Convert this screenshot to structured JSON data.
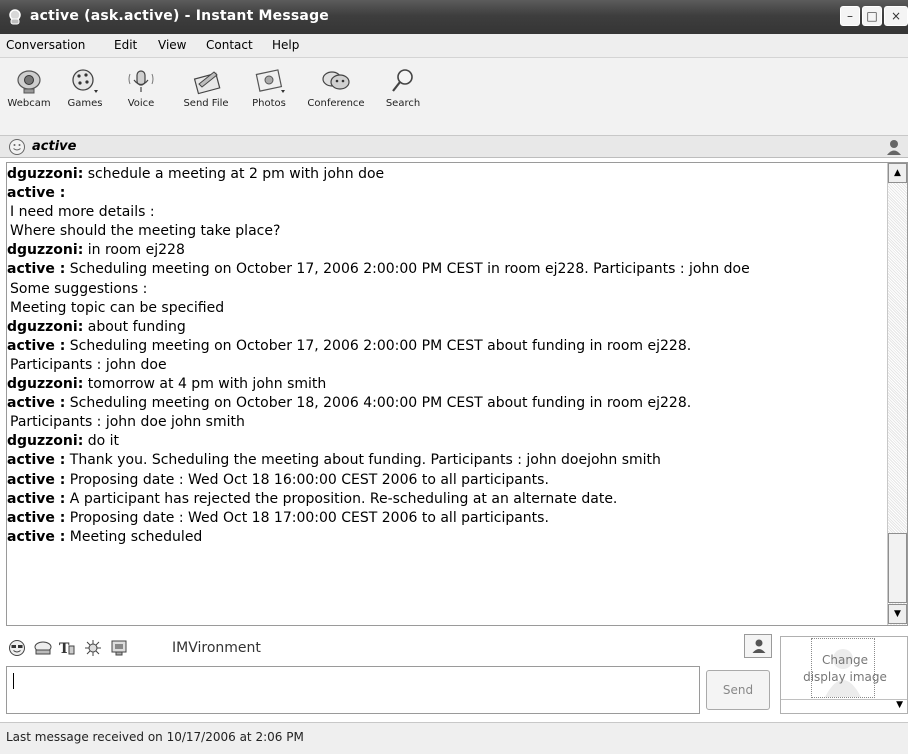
{
  "window": {
    "title": "active  (ask.active) - Instant Message",
    "controls": {
      "minimize": "–",
      "maximize": "□",
      "close": "×"
    }
  },
  "menu": [
    "Conversation",
    "Edit",
    "View",
    "Contact",
    "Help"
  ],
  "toolbar": [
    {
      "label": "Webcam",
      "icon": "webcam-icon"
    },
    {
      "label": "Games",
      "icon": "games-icon"
    },
    {
      "label": "Voice",
      "icon": "voice-icon"
    },
    {
      "label": "Send File",
      "icon": "send-file-icon"
    },
    {
      "label": "Photos",
      "icon": "photos-icon"
    },
    {
      "label": "Conference",
      "icon": "conference-icon"
    },
    {
      "label": "Search",
      "icon": "search-icon"
    }
  ],
  "contact": {
    "name": "active",
    "status_icon": "smiley-icon"
  },
  "conversation": [
    {
      "sender": "dguzzoni:",
      "text": " schedule a meeting at 2 pm with john doe"
    },
    {
      "sender": "active :",
      "text": ""
    },
    {
      "sender": "",
      "text": "I need more details :"
    },
    {
      "sender": "",
      "text": "Where should the meeting take place?"
    },
    {
      "sender": "dguzzoni:",
      "text": " in room ej228"
    },
    {
      "sender": "active :",
      "text": " Scheduling meeting on October 17, 2006 2:00:00 PM CEST in room ej228. Participants :  john doe"
    },
    {
      "sender": "",
      "text": "Some suggestions :"
    },
    {
      "sender": "",
      "text": "Meeting topic can be specified"
    },
    {
      "sender": "dguzzoni:",
      "text": " about funding"
    },
    {
      "sender": "active :",
      "text": " Scheduling meeting on October 17, 2006 2:00:00 PM CEST about funding in room ej228."
    },
    {
      "sender": "",
      "text": "Participants :  john doe"
    },
    {
      "sender": "dguzzoni:",
      "text": " tomorrow at 4 pm with john smith"
    },
    {
      "sender": "active :",
      "text": " Scheduling meeting on October 18, 2006 4:00:00 PM CEST about funding in room ej228."
    },
    {
      "sender": "",
      "text": "Participants :  john doe john smith"
    },
    {
      "sender": "dguzzoni:",
      "text": " do it"
    },
    {
      "sender": "active :",
      "text": " Thank you. Scheduling the meeting about funding. Participants : john doejohn smith"
    },
    {
      "sender": "active :",
      "text": " Proposing date : Wed Oct 18 16:00:00 CEST 2006 to all participants."
    },
    {
      "sender": "active :",
      "text": " A participant has rejected the proposition. Re-scheduling at an alternate date."
    },
    {
      "sender": "active :",
      "text": " Proposing date : Wed Oct 18 17:00:00 CEST 2006 to all participants."
    },
    {
      "sender": "active :",
      "text": " Meeting scheduled"
    }
  ],
  "format_bar": {
    "icons": [
      "emoticon-icon",
      "wink-icon",
      "font-icon",
      "sparkle-icon",
      "imvironment-icon"
    ],
    "imvironment_label": "IMVironment"
  },
  "input": {
    "value": ""
  },
  "send_button": {
    "label": "Send"
  },
  "display_image": {
    "line1": "Change",
    "line2": "display image"
  },
  "status": {
    "text": "Last message received on 10/17/2006 at 2:06 PM"
  }
}
